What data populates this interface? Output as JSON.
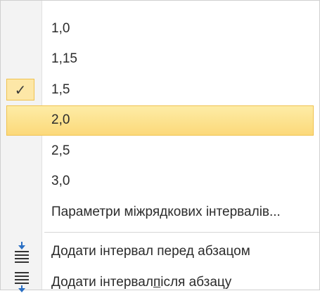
{
  "menu": {
    "spacing_options": [
      {
        "label": "1,0",
        "checked": false,
        "highlighted": false
      },
      {
        "label": "1,15",
        "checked": false,
        "highlighted": false
      },
      {
        "label": "1,5",
        "checked": true,
        "highlighted": false
      },
      {
        "label": "2,0",
        "checked": false,
        "highlighted": true
      },
      {
        "label": "2,5",
        "checked": false,
        "highlighted": false
      },
      {
        "label": "3,0",
        "checked": false,
        "highlighted": false
      }
    ],
    "options_label": "Параметри міжрядкових інтервалів...",
    "add_before_label": "Додати інтервал перед абзацом",
    "add_after_prefix": "Додати інтервал ",
    "add_after_mnemonic": "п",
    "add_after_suffix": "ісля абзацу",
    "check_glyph": "✓",
    "icons": {
      "add_before": "spacing-before-icon",
      "add_after": "spacing-after-icon"
    },
    "colors": {
      "highlight": "#fcd97a",
      "highlight_border": "#f0c24f",
      "arrow_blue": "#2a6fc4",
      "gutter": "#f3f3f3"
    }
  }
}
